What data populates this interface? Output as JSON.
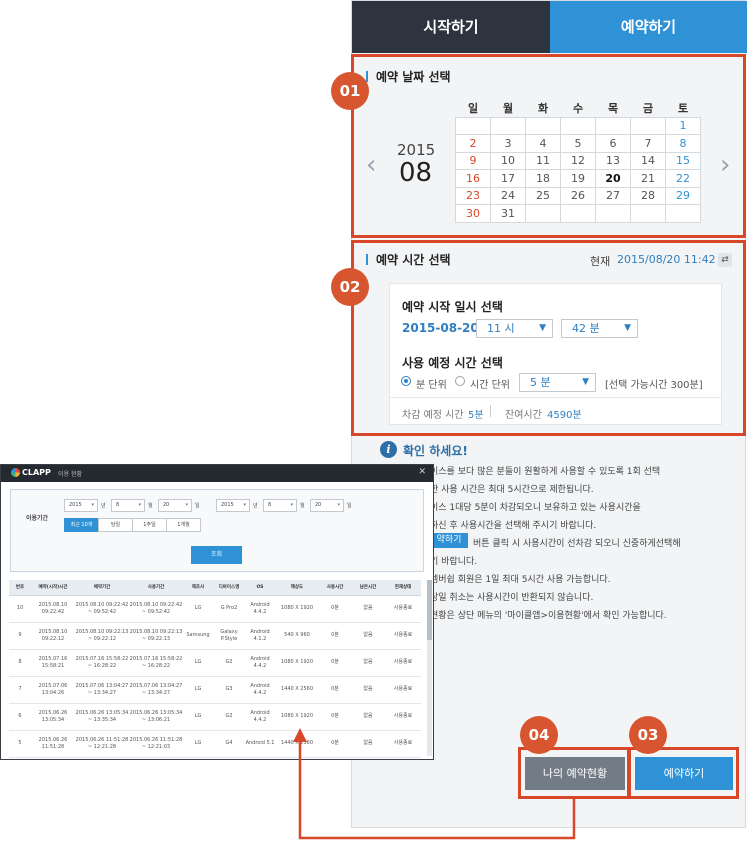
{
  "tabs": {
    "start": "시작하기",
    "reserve": "예약하기"
  },
  "badges": [
    "01",
    "02",
    "03",
    "04"
  ],
  "date_section": {
    "title": "예약 날짜 선택",
    "year": "2015",
    "month": "08",
    "weekdays": [
      "일",
      "월",
      "화",
      "수",
      "목",
      "금",
      "토"
    ],
    "weeks": [
      [
        "",
        "",
        "",
        "",
        "",
        "",
        "1"
      ],
      [
        "2",
        "3",
        "4",
        "5",
        "6",
        "7",
        "8"
      ],
      [
        "9",
        "10",
        "11",
        "12",
        "13",
        "14",
        "15"
      ],
      [
        "16",
        "17",
        "18",
        "19",
        "20",
        "21",
        "22"
      ],
      [
        "23",
        "24",
        "25",
        "26",
        "27",
        "28",
        "29"
      ],
      [
        "30",
        "31",
        "",
        "",
        "",
        "",
        ""
      ]
    ],
    "selected_day": "20"
  },
  "time_section": {
    "title": "예약 시간 선택",
    "now_label": "현재",
    "now_value": "2015/08/20 11:42",
    "start_label": "예약 시작 일시 선택",
    "start_date": "2015-08-20",
    "hour": "11 시",
    "minute": "42 분",
    "usage_label": "사용 예정 시간 선택",
    "unit_minute": "분 단위",
    "unit_hour": "시간 단위",
    "duration": "5 분",
    "available": "[선택 가능시간 300분]",
    "deduct_label": "차감 예정 시간",
    "deduct_value": "5분",
    "remain_label": "잔여시간",
    "remain_value": "4590분"
  },
  "notice": {
    "title": "확인 하세요!",
    "lines": [
      "이스를 보다 많은 분들이 원활하게 사용할 수 있도록 1회 선택",
      "한 사용 시간은 최대 5시간으로 제한됩니다.",
      "이스 1대당 5분이 차감되오니 보유하고 있는 사용시간을",
      "하신 후 사용시간을 선택해 주시기 바랍니다.",
      "버튼 클릭 시 사용시간이 선차감 되오니 신중하게선택해",
      "기 바랍니다.",
      "멤버쉽 회원은 1일 최대 5시간 사용 가능합니다.",
      "당일 취소는 사용시간이 반환되지 않습니다.",
      "현황은 상단 메뉴의 '마이클앱>이용현황'에서 확인 가능합니다."
    ],
    "highlight": "약하기"
  },
  "bottom": {
    "my_status": "나의 예약현황",
    "reserve": "예약하기"
  },
  "usage_window": {
    "logo": "CLAPP",
    "title": "이용 현황",
    "close": "✕",
    "period_label": "이용기간",
    "from": {
      "year": "2015",
      "month": "8",
      "day": "20"
    },
    "to": {
      "year": "2015",
      "month": "8",
      "day": "20"
    },
    "units": {
      "y": "년",
      "m": "월",
      "d": "일"
    },
    "range_buttons": [
      "최근 10개",
      "당일",
      "1주일",
      "1개월"
    ],
    "search": "조회",
    "columns": [
      "번호",
      "예약(시작)시간",
      "예약기간",
      "사용기간",
      "제조사",
      "디바이스명",
      "OS",
      "해상도",
      "사용시간",
      "남은시간",
      "현재상태"
    ],
    "rows": [
      [
        "10",
        "2015.08.10 09:22:42",
        "2015.08.10 09:22:42 ~ 09:52:42",
        "2015.08.10 09:22:42 ~ 09:52:42",
        "LG",
        "G Pro2",
        "Android 4.4.2",
        "1080 X 1920",
        "0분",
        "없음",
        "사용종료"
      ],
      [
        "9",
        "2015.08.10 09:22:12",
        "2015.08.10 09:22:13 ~ 09:22:12",
        "2015.08.10 09:22:13 ~ 09:22:13",
        "Samsung",
        "Galaxy P.Style",
        "Android 4.1.2",
        "540 X 960",
        "0분",
        "없음",
        "사용종료"
      ],
      [
        "8",
        "2015.07.16 15:58:21",
        "2015.07.16 15:58:22 ~ 16:28:22",
        "2015.07.16 15:58:22 ~ 16:28:22",
        "LG",
        "G2",
        "Android 4.4.2",
        "1080 X 1920",
        "0분",
        "없음",
        "사용종료"
      ],
      [
        "7",
        "2015.07.06 13:04:26",
        "2015.07.06 13:04:27 ~ 13:34:27",
        "2015.07.06 13:04:27 ~ 13:34:27",
        "LG",
        "G3",
        "Android 4.4.2",
        "1440 X 2560",
        "0분",
        "없음",
        "사용종료"
      ],
      [
        "6",
        "2015.06.26 13:05:34",
        "2015.06.26 13:05:34 ~ 13:35:34",
        "2015.06.26 13:05:34 ~ 13:06:21",
        "LG",
        "G2",
        "Android 4.4.2",
        "1080 X 1920",
        "0분",
        "없음",
        "사용종료"
      ],
      [
        "5",
        "2015.06.26 11:51:28",
        "2015.06.26 11:51:28 ~ 12:21:28",
        "2015.06.26 11:51:28 ~ 12:21:03",
        "LG",
        "G4",
        "Android 5.1",
        "1440 X 2560",
        "0분",
        "없음",
        "사용종료"
      ]
    ]
  }
}
